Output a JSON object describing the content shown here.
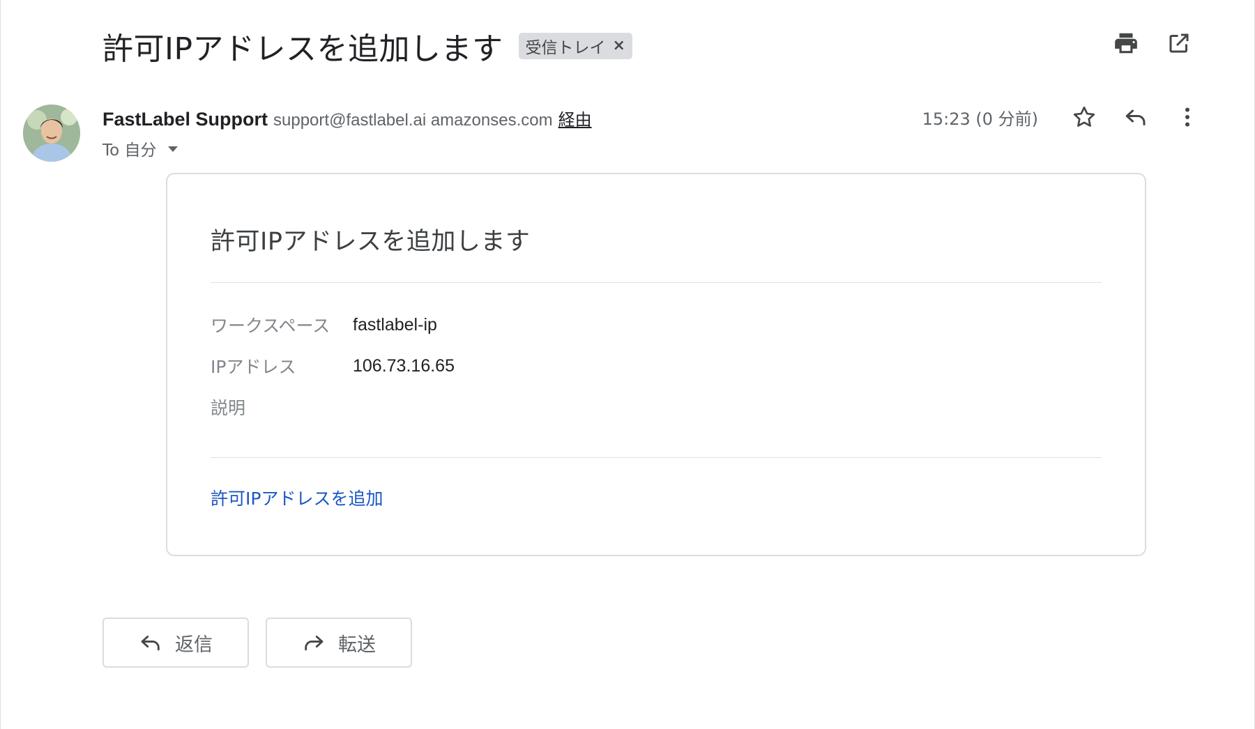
{
  "email": {
    "subject": "許可IPアドレスを追加します",
    "label_chip": "受信トレイ",
    "label_chip_close": "×",
    "sender": {
      "name": "FastLabel Support",
      "email": "support@fastlabel.ai amazonses.com",
      "via": "経由"
    },
    "to": "To 自分",
    "timestamp": "15:23 (0 分前)"
  },
  "body": {
    "title": "許可IPアドレスを追加します",
    "fields": [
      {
        "label": "ワークスペース",
        "value": "fastlabel-ip"
      },
      {
        "label": "IPアドレス",
        "value": "106.73.16.65"
      },
      {
        "label": "説明",
        "value": ""
      }
    ],
    "link_text": "許可IPアドレスを追加"
  },
  "buttons": {
    "reply_label": "返信",
    "forward_label": "転送"
  },
  "icons": {
    "print": "print-icon",
    "open_new_window": "open-in-new-icon",
    "star": "star-icon",
    "reply": "reply-icon",
    "more": "more-vert-icon",
    "forward": "forward-icon"
  },
  "colors": {
    "link": "#1a56c4",
    "chip_bg": "#dadce0",
    "border": "#dadce0",
    "text_secondary": "#5f6368"
  }
}
